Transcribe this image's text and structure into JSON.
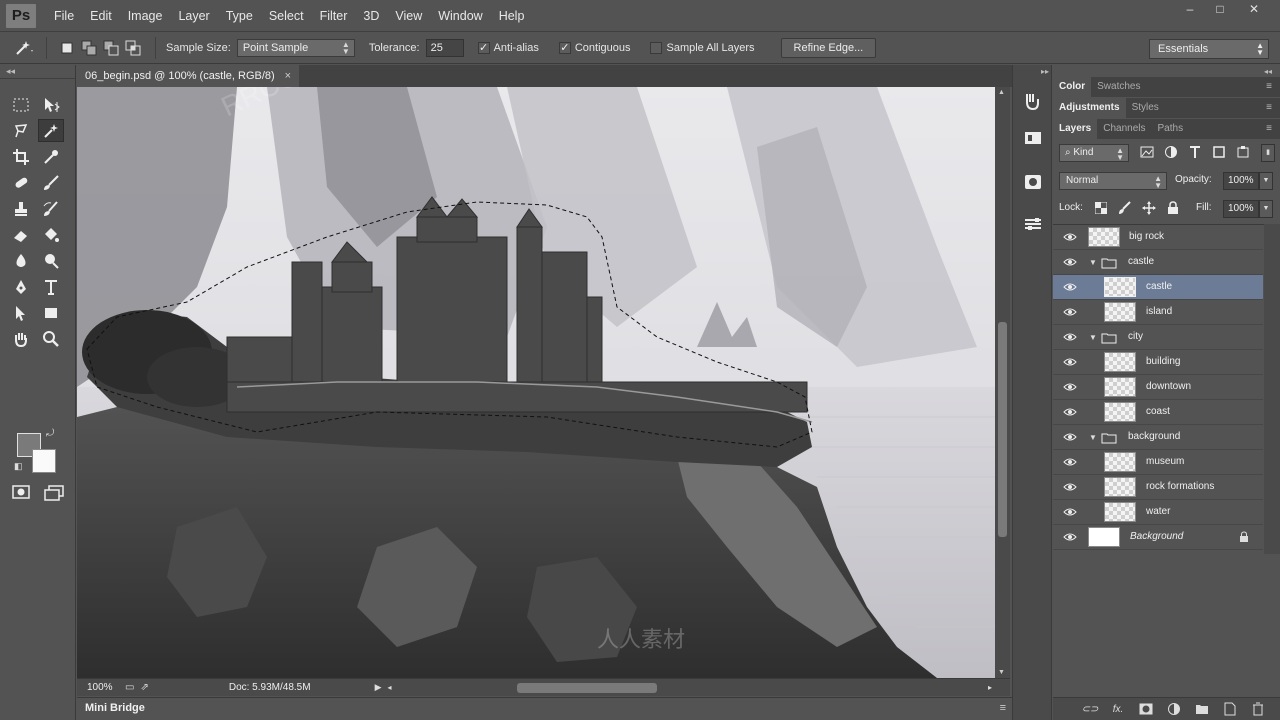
{
  "app": {
    "logo": "Ps"
  },
  "menu": [
    "File",
    "Edit",
    "Image",
    "Layer",
    "Type",
    "Select",
    "Filter",
    "3D",
    "View",
    "Window",
    "Help"
  ],
  "window_controls": {
    "minimize": "–",
    "maximize": "□",
    "close": "✕"
  },
  "options": {
    "sample_size_label": "Sample Size:",
    "sample_size_value": "Point Sample",
    "tolerance_label": "Tolerance:",
    "tolerance_value": "25",
    "anti_alias_label": "Anti-alias",
    "anti_alias_checked": true,
    "contiguous_label": "Contiguous",
    "contiguous_checked": true,
    "sample_all_layers_label": "Sample All Layers",
    "sample_all_layers_checked": false,
    "refine_edge_label": "Refine Edge...",
    "workspace": "Essentials"
  },
  "document": {
    "tab_title": "06_begin.psd @ 100% (castle, RGB/8)",
    "tab_close": "×",
    "zoom": "100%",
    "doc_size": "Doc: 5.93M/48.5M"
  },
  "mini_bridge": {
    "label": "Mini Bridge"
  },
  "panels": {
    "color_tabs": [
      "Color",
      "Swatches"
    ],
    "adjust_tabs": [
      "Adjustments",
      "Styles"
    ],
    "layers_tabs": [
      "Layers",
      "Channels",
      "Paths"
    ],
    "kind_label": "Kind",
    "blend_mode": "Normal",
    "opacity_label": "Opacity:",
    "opacity_value": "100%",
    "lock_label": "Lock:",
    "fill_label": "Fill:",
    "fill_value": "100%"
  },
  "layers": [
    {
      "name": "big rock",
      "type": "layer",
      "indent": 0,
      "selected": false,
      "italic": false
    },
    {
      "name": "castle",
      "type": "group",
      "indent": 0,
      "selected": false,
      "italic": false
    },
    {
      "name": "castle",
      "type": "layer",
      "indent": 1,
      "selected": true,
      "italic": false
    },
    {
      "name": "island",
      "type": "layer",
      "indent": 1,
      "selected": false,
      "italic": false
    },
    {
      "name": "city",
      "type": "group",
      "indent": 0,
      "selected": false,
      "italic": false
    },
    {
      "name": "building",
      "type": "layer",
      "indent": 1,
      "selected": false,
      "italic": false
    },
    {
      "name": "downtown",
      "type": "layer",
      "indent": 1,
      "selected": false,
      "italic": false
    },
    {
      "name": "coast",
      "type": "layer",
      "indent": 1,
      "selected": false,
      "italic": false
    },
    {
      "name": "background",
      "type": "group",
      "indent": 0,
      "selected": false,
      "italic": false
    },
    {
      "name": "museum",
      "type": "layer",
      "indent": 1,
      "selected": false,
      "italic": false
    },
    {
      "name": "rock formations",
      "type": "layer",
      "indent": 1,
      "selected": false,
      "italic": false
    },
    {
      "name": "water",
      "type": "layer",
      "indent": 1,
      "selected": false,
      "italic": false
    },
    {
      "name": "Background",
      "type": "background",
      "indent": 0,
      "selected": false,
      "italic": true
    }
  ],
  "layers_footer": {
    "fx_label": "fx."
  },
  "colors": {
    "selected_layer": "#6c7c96",
    "panel_bg": "#535353",
    "dark_bg": "#424242"
  }
}
